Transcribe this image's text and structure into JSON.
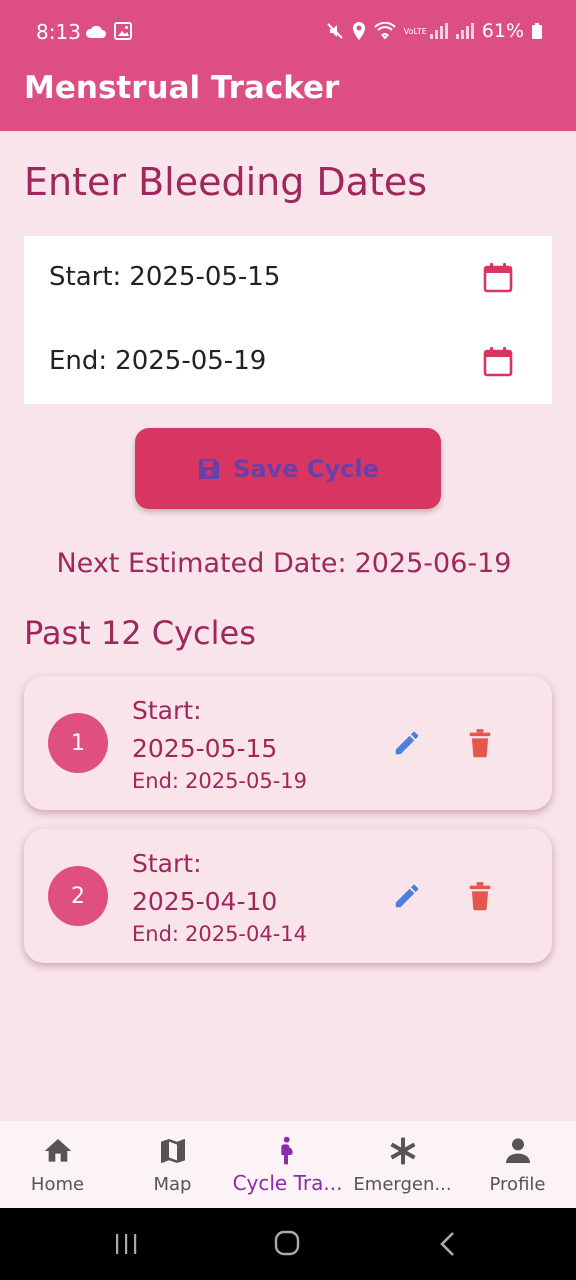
{
  "status_bar": {
    "time": "8:13",
    "battery": "61%",
    "volte": "VoLTE"
  },
  "app_bar": {
    "title": "Menstrual Tracker"
  },
  "enter_section": {
    "heading": "Enter Bleeding Dates",
    "start": {
      "label": "Start:",
      "value": "2025-05-15"
    },
    "end": {
      "label": "End:",
      "value": "2025-05-19"
    },
    "save_label": "Save Cycle"
  },
  "next_estimate": {
    "label": "Next Estimated Date:",
    "value": "2025-06-19"
  },
  "past": {
    "heading": "Past 12 Cycles",
    "cycles": [
      {
        "number": "1",
        "start_label": "Start:",
        "start": "2025-05-15",
        "end_label": "End:",
        "end": "2025-05-19"
      },
      {
        "number": "2",
        "start_label": "Start:",
        "start": "2025-04-10",
        "end_label": "End:",
        "end": "2025-04-14"
      }
    ]
  },
  "bottom_nav": {
    "items": [
      {
        "label": "Home",
        "icon": "home-icon"
      },
      {
        "label": "Map",
        "icon": "map-icon"
      },
      {
        "label": "Cycle Tra...",
        "icon": "pregnant-person-icon",
        "active": true
      },
      {
        "label": "Emergen...",
        "icon": "asterisk-icon"
      },
      {
        "label": "Profile",
        "icon": "person-icon"
      }
    ]
  },
  "colors": {
    "primary": "#dd4f82",
    "background": "#f8e4ea",
    "heading_text": "#a0275c",
    "button": "#d73662",
    "button_text": "#6a3fa8",
    "edit": "#4c7ee0",
    "delete": "#e4574c",
    "nav_active": "#8e2bab"
  }
}
